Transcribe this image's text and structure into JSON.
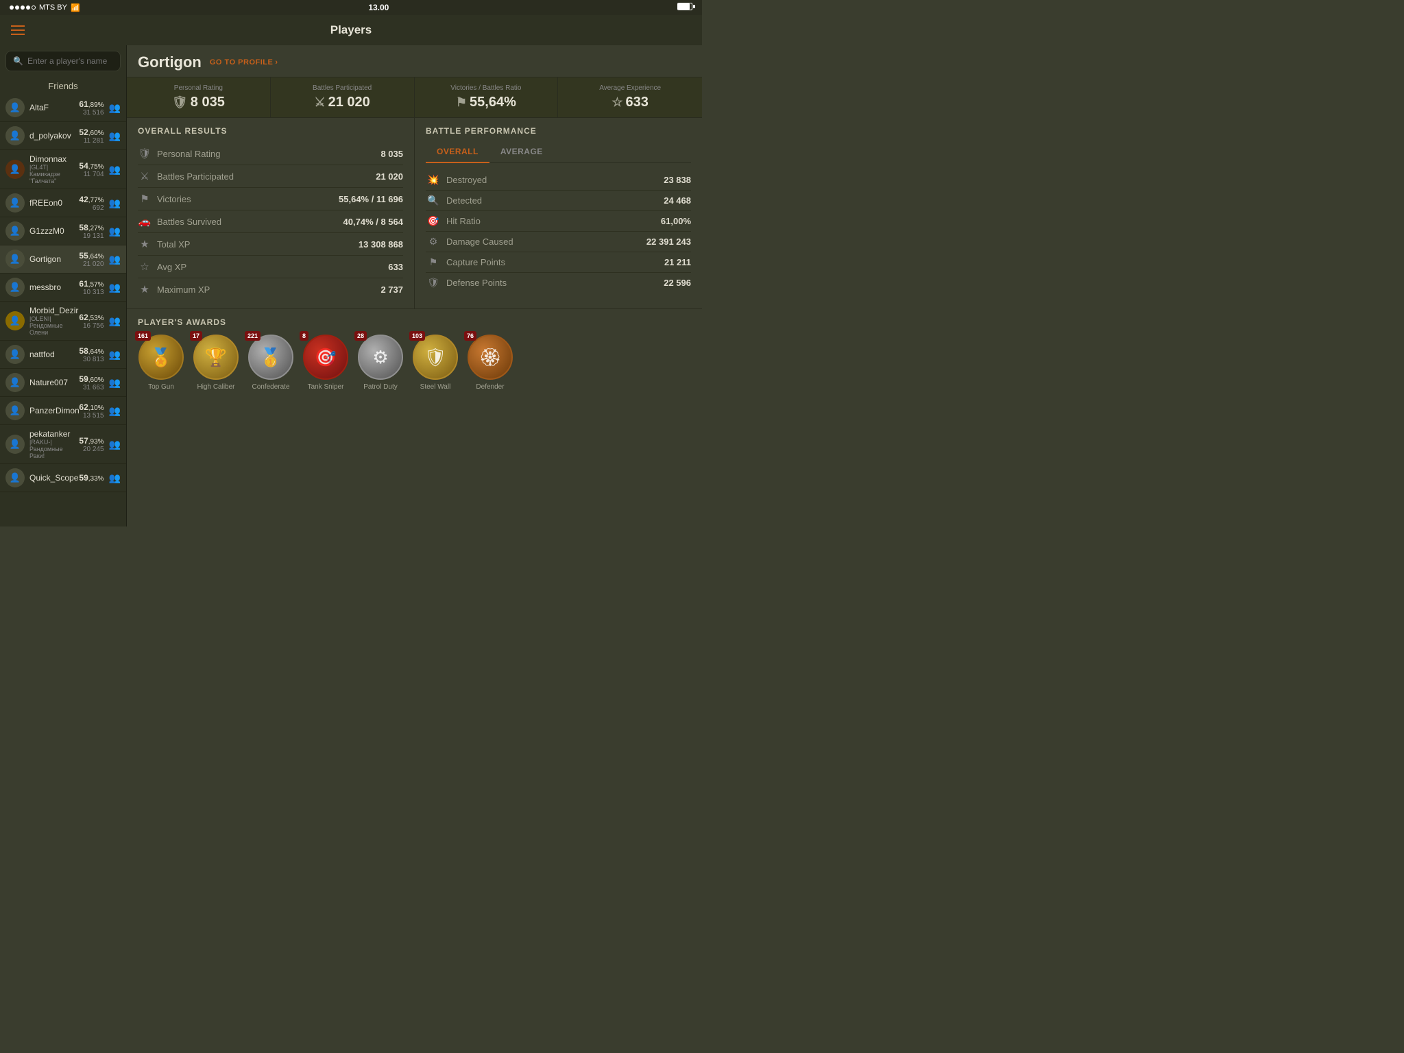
{
  "status": {
    "carrier": "MTS BY",
    "time": "13.00",
    "signal_dots": 5
  },
  "nav": {
    "title": "Players",
    "menu_label": "Menu"
  },
  "search": {
    "placeholder": "Enter a player's name"
  },
  "sidebar": {
    "header": "Friends",
    "friends": [
      {
        "name": "AltaF",
        "clan": "",
        "pct_big": "61",
        "pct_small": "89%",
        "battles": "31 516"
      },
      {
        "name": "d_polyakov",
        "clan": "",
        "pct_big": "52",
        "pct_small": "60%",
        "battles": "11 281"
      },
      {
        "name": "Dimonnax",
        "clan": "|GL4T| Камикадзе \"Галчата\"",
        "pct_big": "54",
        "pct_small": "75%",
        "battles": "11 704"
      },
      {
        "name": "fREEon0",
        "clan": "",
        "pct_big": "42",
        "pct_small": "77%",
        "battles": "692"
      },
      {
        "name": "G1zzzM0",
        "clan": "",
        "pct_big": "58",
        "pct_small": "27%",
        "battles": "19 131"
      },
      {
        "name": "Gortigon",
        "clan": "",
        "pct_big": "55",
        "pct_small": "64%",
        "battles": "21 020"
      },
      {
        "name": "messbro",
        "clan": "",
        "pct_big": "61",
        "pct_small": "57%",
        "battles": "10 313"
      },
      {
        "name": "Morbid_Dezir",
        "clan": "|OLENI| Рендомные Олени",
        "pct_big": "62",
        "pct_small": "53%",
        "battles": "16 756"
      },
      {
        "name": "nattfod",
        "clan": "",
        "pct_big": "58",
        "pct_small": "64%",
        "battles": "30 813"
      },
      {
        "name": "Nature007",
        "clan": "",
        "pct_big": "59",
        "pct_small": "60%",
        "battles": "31 663"
      },
      {
        "name": "PanzerDimon",
        "clan": "",
        "pct_big": "62",
        "pct_small": "10%",
        "battles": "13 515"
      },
      {
        "name": "pekatanker",
        "clan": "|RAKU-| Рандомные Раки!",
        "pct_big": "57",
        "pct_small": "93%",
        "battles": "20 245"
      },
      {
        "name": "Quick_Scope",
        "clan": "",
        "pct_big": "59",
        "pct_small": "33%",
        "battles": ""
      }
    ]
  },
  "player": {
    "name": "Gortigon",
    "go_to_profile": "GO TO PROFILE",
    "stats": {
      "personal_rating_label": "Personal Rating",
      "personal_rating_value": "8 035",
      "battles_label": "Battles Participated",
      "battles_value": "21 020",
      "victories_label": "Victories / Battles Ratio",
      "victories_value": "55,64%",
      "avg_exp_label": "Average Experience",
      "avg_exp_value": "633"
    },
    "overall_title": "OVERALL RESULTS",
    "overall_rows": [
      {
        "label": "Personal Rating",
        "value": "8 035"
      },
      {
        "label": "Battles Participated",
        "value": "21 020"
      },
      {
        "label": "Victories",
        "value": "55,64% / 11 696"
      },
      {
        "label": "Battles Survived",
        "value": "40,74% / 8 564"
      },
      {
        "label": "Total XP",
        "value": "13 308 868"
      },
      {
        "label": "Avg XP",
        "value": "633"
      },
      {
        "label": "Maximum XP",
        "value": "2 737"
      }
    ],
    "performance_title": "BATTLE PERFORMANCE",
    "perf_tabs": [
      "OVERALL",
      "AVERAGE"
    ],
    "perf_active_tab": "OVERALL",
    "perf_rows": [
      {
        "label": "Destroyed",
        "value": "23 838"
      },
      {
        "label": "Detected",
        "value": "24 468"
      },
      {
        "label": "Hit Ratio",
        "value": "61,00%"
      },
      {
        "label": "Damage Caused",
        "value": "22 391 243"
      },
      {
        "label": "Capture Points",
        "value": "21 211"
      },
      {
        "label": "Defense Points",
        "value": "22 596"
      }
    ],
    "awards_title": "PLAYER'S AWARDS",
    "awards": [
      {
        "count": "161",
        "name": "Top Gun",
        "color": "gold-dark"
      },
      {
        "count": "17",
        "name": "High Caliber",
        "color": "gold-med"
      },
      {
        "count": "221",
        "name": "Confederate",
        "color": "silver"
      },
      {
        "count": "8",
        "name": "Tank Sniper",
        "color": "red-dark"
      },
      {
        "count": "28",
        "name": "Patrol Duty",
        "color": "silver"
      },
      {
        "count": "103",
        "name": "Steel Wall",
        "color": "gold-med"
      },
      {
        "count": "76",
        "name": "Defender",
        "color": "bronze"
      }
    ]
  },
  "icons": {
    "hamburger": "☰",
    "search": "🔍",
    "shield": "🛡",
    "swords": "⚔",
    "flag": "⚑",
    "tank": "🚗",
    "star": "★",
    "star_outline": "☆",
    "explosion": "💥",
    "target": "🎯",
    "wrench": "🔧",
    "anchor": "⚓",
    "fire": "🔥",
    "award": "🏅",
    "chevron": "›",
    "person": "👤"
  }
}
